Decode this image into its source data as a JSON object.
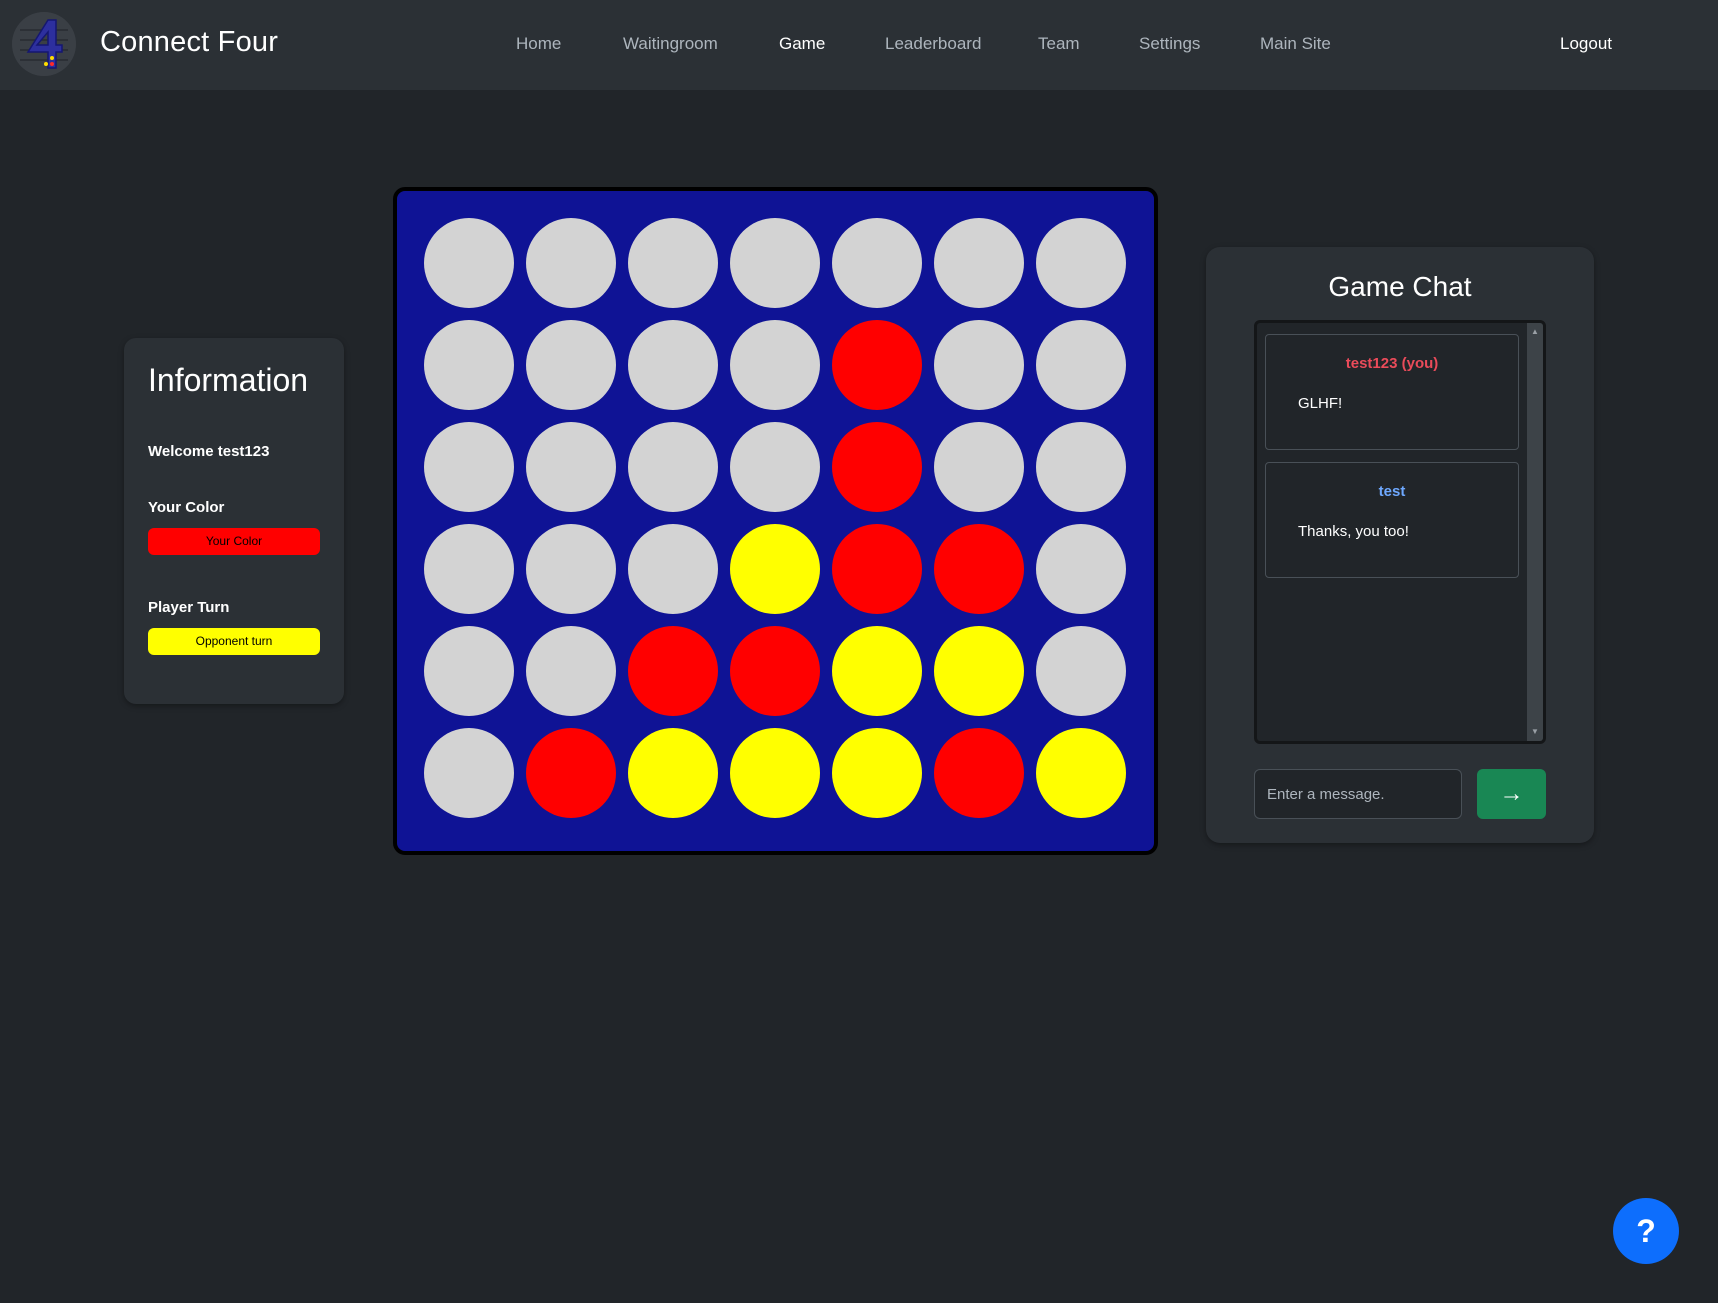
{
  "navbar": {
    "brand_title": "Connect Four",
    "logo_icon": "connect-four-logo-icon",
    "items": [
      {
        "label": "Home",
        "active": false
      },
      {
        "label": "Waitingroom",
        "active": false
      },
      {
        "label": "Game",
        "active": true
      },
      {
        "label": "Leaderboard",
        "active": false
      },
      {
        "label": "Team",
        "active": false
      },
      {
        "label": "Settings",
        "active": false
      },
      {
        "label": "Main Site",
        "active": false
      }
    ],
    "logout_label": "Logout"
  },
  "info": {
    "title": "Information",
    "welcome": "Welcome test123",
    "color_label": "Your Color",
    "color_badge": "Your Color",
    "turn_label": "Player Turn",
    "turn_badge": "Opponent turn"
  },
  "board": {
    "rows": 6,
    "cols": 7,
    "cells": [
      [
        "empty",
        "empty",
        "empty",
        "empty",
        "empty",
        "empty",
        "empty"
      ],
      [
        "empty",
        "empty",
        "empty",
        "empty",
        "red",
        "empty",
        "empty"
      ],
      [
        "empty",
        "empty",
        "empty",
        "empty",
        "red",
        "empty",
        "empty"
      ],
      [
        "empty",
        "empty",
        "empty",
        "yellow",
        "red",
        "red",
        "empty"
      ],
      [
        "empty",
        "empty",
        "red",
        "red",
        "yellow",
        "yellow",
        "empty"
      ],
      [
        "empty",
        "red",
        "yellow",
        "yellow",
        "yellow",
        "red",
        "yellow"
      ]
    ]
  },
  "chat": {
    "title": "Game Chat",
    "messages": [
      {
        "user": "test123 (you)",
        "text": "GLHF!"
      },
      {
        "user": "test",
        "text": "Thanks, you too!"
      }
    ],
    "input_placeholder": "Enter a message.",
    "send_label": "→"
  },
  "help": {
    "label": "?",
    "icon": "help-icon"
  },
  "colors": {
    "background": "#212529",
    "navbar": "#2b3035",
    "board": "#0f1395",
    "empty": "#d3d3d3",
    "red": "#ff0000",
    "yellow": "#ffff00",
    "send": "#198754",
    "help": "#0d6efd"
  }
}
